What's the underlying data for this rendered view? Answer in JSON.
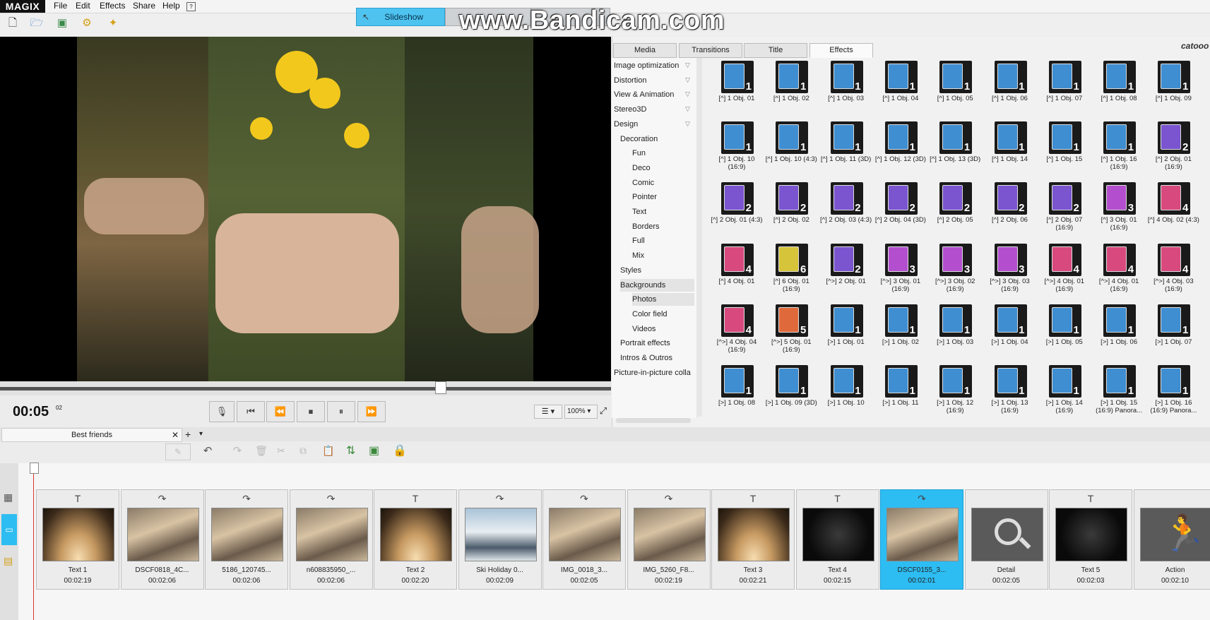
{
  "app": {
    "logo": "MAGIX"
  },
  "menu": [
    "File",
    "Edit",
    "Effects",
    "Share",
    "Help"
  ],
  "mode": {
    "slideshow_label": "Slideshow"
  },
  "watermark": "www.Bandicam.com",
  "preview": {
    "time": "00:05",
    "frames": "02",
    "zoom": "100%",
    "progress": 0.72
  },
  "tabs": [
    "Media",
    "Transitions",
    "Title",
    "Effects"
  ],
  "brand": "catooo",
  "categories": [
    {
      "label": "Image optimization",
      "level": 0
    },
    {
      "label": "Distortion",
      "level": 0
    },
    {
      "label": "View & Animation",
      "level": 0
    },
    {
      "label": "Stereo3D",
      "level": 0
    },
    {
      "label": "Design",
      "level": 0
    },
    {
      "label": "Decoration",
      "level": 1
    },
    {
      "label": "Fun",
      "level": 2
    },
    {
      "label": "Deco",
      "level": 2
    },
    {
      "label": "Comic",
      "level": 2
    },
    {
      "label": "Pointer",
      "level": 2
    },
    {
      "label": "Text",
      "level": 2
    },
    {
      "label": "Borders",
      "level": 2
    },
    {
      "label": "Full",
      "level": 2
    },
    {
      "label": "Mix",
      "level": 2
    },
    {
      "label": "Styles",
      "level": 1
    },
    {
      "label": "Backgrounds",
      "level": 1
    },
    {
      "label": "Photos",
      "level": 2
    },
    {
      "label": "Color field",
      "level": 2
    },
    {
      "label": "Videos",
      "level": 2
    },
    {
      "label": "Portrait effects",
      "level": 1
    },
    {
      "label": "Intros & Outros",
      "level": 1
    },
    {
      "label": "Picture-in-picture colla",
      "level": 0
    }
  ],
  "effects": [
    {
      "label": "[^] 1 Obj. 01",
      "num": "1",
      "color": "#3f8ed1"
    },
    {
      "label": "[^] 1 Obj. 02",
      "num": "1",
      "color": "#3f8ed1"
    },
    {
      "label": "[^] 1 Obj. 03",
      "num": "1",
      "color": "#3f8ed1"
    },
    {
      "label": "[^] 1 Obj. 04",
      "num": "1",
      "color": "#3f8ed1"
    },
    {
      "label": "[^] 1 Obj. 05",
      "num": "1",
      "color": "#3f8ed1"
    },
    {
      "label": "[^] 1 Obj. 06",
      "num": "1",
      "color": "#3f8ed1"
    },
    {
      "label": "[^] 1 Obj. 07",
      "num": "1",
      "color": "#3f8ed1"
    },
    {
      "label": "[^] 1 Obj. 08",
      "num": "1",
      "color": "#3f8ed1"
    },
    {
      "label": "[^] 1 Obj. 09",
      "num": "1",
      "color": "#3f8ed1"
    },
    {
      "label": "[^] 1 Obj. 10 (16:9)",
      "num": "1",
      "color": "#3f8ed1"
    },
    {
      "label": "[^] 1 Obj. 10 (4:3)",
      "num": "1",
      "color": "#3f8ed1"
    },
    {
      "label": "[^] 1 Obj. 11 (3D)",
      "num": "1",
      "color": "#3f8ed1"
    },
    {
      "label": "[^] 1 Obj. 12 (3D)",
      "num": "1",
      "color": "#3f8ed1"
    },
    {
      "label": "[^] 1 Obj. 13 (3D)",
      "num": "1",
      "color": "#3f8ed1"
    },
    {
      "label": "[^] 1 Obj. 14",
      "num": "1",
      "color": "#3f8ed1"
    },
    {
      "label": "[^] 1 Obj. 15",
      "num": "1",
      "color": "#3f8ed1"
    },
    {
      "label": "[^] 1 Obj. 16 (16:9)",
      "num": "1",
      "color": "#3f8ed1"
    },
    {
      "label": "[^] 2 Obj. 01 (16:9)",
      "num": "2",
      "color": "#7a55cf"
    },
    {
      "label": "[^] 2 Obj. 01 (4:3)",
      "num": "2",
      "color": "#7a55cf"
    },
    {
      "label": "[^] 2 Obj. 02",
      "num": "2",
      "color": "#7a55cf"
    },
    {
      "label": "[^] 2 Obj. 03 (4:3)",
      "num": "2",
      "color": "#7a55cf"
    },
    {
      "label": "[^] 2 Obj. 04 (3D)",
      "num": "2",
      "color": "#7a55cf"
    },
    {
      "label": "[^] 2 Obj. 05",
      "num": "2",
      "color": "#7a55cf"
    },
    {
      "label": "[^] 2 Obj. 06",
      "num": "2",
      "color": "#7a55cf"
    },
    {
      "label": "[^] 2 Obj. 07 (16:9)",
      "num": "2",
      "color": "#7a55cf"
    },
    {
      "label": "[^] 3 Obj. 01 (16:9)",
      "num": "3",
      "color": "#b34fce"
    },
    {
      "label": "[^] 4 Obj. 02 (4:3)",
      "num": "4",
      "color": "#d84a7e"
    },
    {
      "label": "[^] 4 Obj. 01",
      "num": "4",
      "color": "#d84a7e"
    },
    {
      "label": "[^] 6 Obj. 01 (16:9)",
      "num": "6",
      "color": "#d6c43a"
    },
    {
      "label": "[^>] 2 Obj. 01",
      "num": "2",
      "color": "#7a55cf"
    },
    {
      "label": "[^>] 3 Obj. 01 (16:9)",
      "num": "3",
      "color": "#b34fce"
    },
    {
      "label": "[^>] 3 Obj. 02 (16:9)",
      "num": "3",
      "color": "#b34fce"
    },
    {
      "label": "[^>] 3 Obj. 03 (16:9)",
      "num": "3",
      "color": "#b34fce"
    },
    {
      "label": "[^>] 4 Obj. 01 (16:9)",
      "num": "4",
      "color": "#d84a7e"
    },
    {
      "label": "[^>] 4 Obj. 01 (16:9)",
      "num": "4",
      "color": "#d84a7e"
    },
    {
      "label": "[^>] 4 Obj. 03 (16:9)",
      "num": "4",
      "color": "#d84a7e"
    },
    {
      "label": "[^>] 4 Obj. 04 (16:9)",
      "num": "4",
      "color": "#d84a7e"
    },
    {
      "label": "[^>] 5 Obj. 01 (16:9)",
      "num": "5",
      "color": "#e0693c"
    },
    {
      "label": "[>] 1 Obj. 01",
      "num": "1",
      "color": "#3f8ed1"
    },
    {
      "label": "[>] 1 Obj. 02",
      "num": "1",
      "color": "#3f8ed1"
    },
    {
      "label": "[>] 1 Obj. 03",
      "num": "1",
      "color": "#3f8ed1"
    },
    {
      "label": "[>] 1 Obj. 04",
      "num": "1",
      "color": "#3f8ed1"
    },
    {
      "label": "[>] 1 Obj. 05",
      "num": "1",
      "color": "#3f8ed1"
    },
    {
      "label": "[>] 1 Obj. 06",
      "num": "1",
      "color": "#3f8ed1"
    },
    {
      "label": "[>] 1 Obj. 07",
      "num": "1",
      "color": "#3f8ed1"
    },
    {
      "label": "[>] 1 Obj. 08",
      "num": "1",
      "color": "#3f8ed1"
    },
    {
      "label": "[>] 1 Obj. 09 (3D)",
      "num": "1",
      "color": "#3f8ed1"
    },
    {
      "label": "[>] 1 Obj. 10",
      "num": "1",
      "color": "#3f8ed1"
    },
    {
      "label": "[>] 1 Obj. 11",
      "num": "1",
      "color": "#3f8ed1"
    },
    {
      "label": "[>] 1 Obj. 12 (16:9)",
      "num": "1",
      "color": "#3f8ed1"
    },
    {
      "label": "[>] 1 Obj. 13 (16:9)",
      "num": "1",
      "color": "#3f8ed1"
    },
    {
      "label": "[>] 1 Obj. 14 (16:9)",
      "num": "1",
      "color": "#3f8ed1"
    },
    {
      "label": "[>] 1 Obj. 15 (16:9) Panora...",
      "num": "1",
      "color": "#3f8ed1"
    },
    {
      "label": "[>] 1 Obj. 16 (16:9) Panora...",
      "num": "1",
      "color": "#3f8ed1"
    }
  ],
  "project": {
    "tab_label": "Best friends"
  },
  "clips": [
    {
      "type": "T",
      "name": "Text 1",
      "dur": "00:02:19",
      "thumb": "glow"
    },
    {
      "type": "↷",
      "name": "DSCF0818_4C...",
      "dur": "00:02:06",
      "thumb": "photo"
    },
    {
      "type": "↷",
      "name": "5186_120745...",
      "dur": "00:02:06",
      "thumb": "photo"
    },
    {
      "type": "↷",
      "name": "n608835950_...",
      "dur": "00:02:06",
      "thumb": "photo"
    },
    {
      "type": "T",
      "name": "Text 2",
      "dur": "00:02:20",
      "thumb": "glow"
    },
    {
      "type": "↷",
      "name": "Ski Holiday 0...",
      "dur": "00:02:09",
      "thumb": "snow"
    },
    {
      "type": "↷",
      "name": "IMG_0018_3...",
      "dur": "00:02:05",
      "thumb": "photo"
    },
    {
      "type": "↷",
      "name": "IMG_5260_F8...",
      "dur": "00:02:19",
      "thumb": "photo"
    },
    {
      "type": "T",
      "name": "Text 3",
      "dur": "00:02:21",
      "thumb": "glow"
    },
    {
      "type": "T",
      "name": "Text 4",
      "dur": "00:02:15",
      "thumb": "dark"
    },
    {
      "type": "↷",
      "name": "DSCF0155_3...",
      "dur": "00:02:01",
      "thumb": "photo",
      "selected": true
    },
    {
      "type": "",
      "name": "Detail",
      "dur": "00:02:05",
      "thumb": "search"
    },
    {
      "type": "T",
      "name": "Text 5",
      "dur": "00:02:03",
      "thumb": "dark"
    },
    {
      "type": "",
      "name": "Action",
      "dur": "00:02:10",
      "thumb": "run"
    }
  ],
  "colors": {
    "accent": "#2dbdf2",
    "playhead": "#dd3333"
  }
}
